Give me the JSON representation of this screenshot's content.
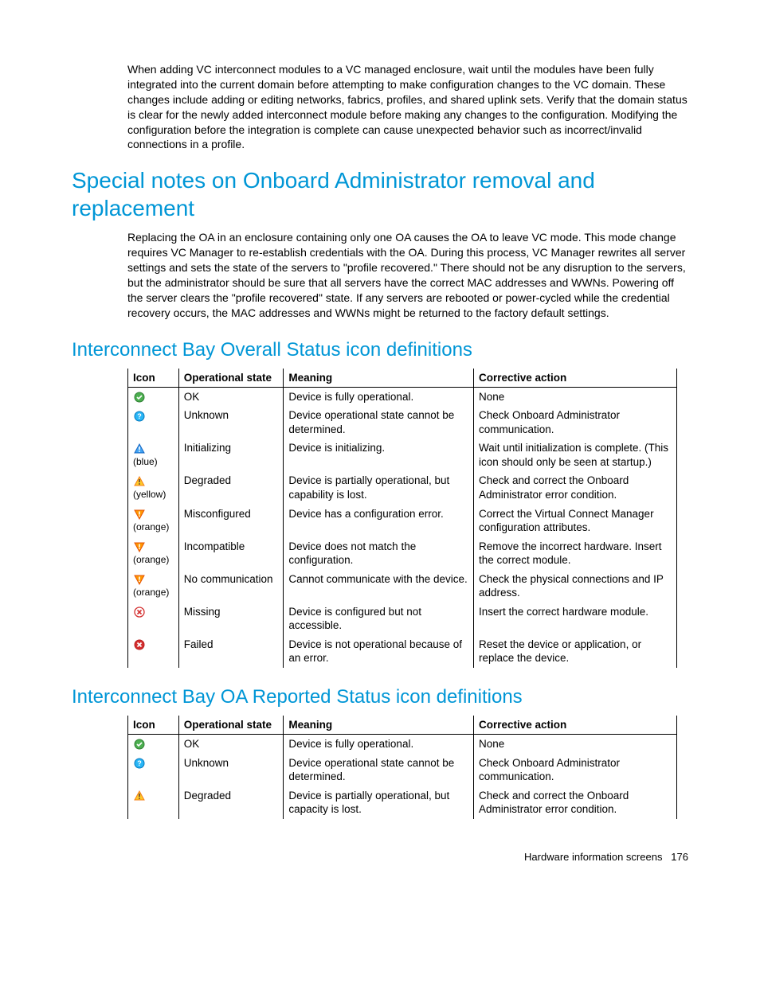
{
  "intro_para": "When adding VC interconnect modules to a VC managed enclosure, wait until the modules have been fully integrated into the current domain before attempting to make configuration changes to the VC domain. These changes include adding or editing networks, fabrics, profiles, and shared uplink sets. Verify that the domain status is clear for the newly added interconnect module before making any changes to the configuration. Modifying the configuration before the integration is complete can cause unexpected behavior such as incorrect/invalid connections in a profile.",
  "heading_special": "Special notes on Onboard Administrator removal and replacement",
  "special_para": "Replacing the OA in an enclosure containing only one OA causes the OA to leave VC mode. This mode change requires VC Manager to re-establish credentials with the OA. During this process, VC Manager rewrites all server settings and sets the state of the servers to \"profile recovered.\" There should not be any disruption to the servers, but the administrator should be sure that all servers have the correct MAC addresses and WWNs. Powering off the server clears the \"profile recovered\" state. If any servers are rebooted or power-cycled while the credential recovery occurs, the MAC addresses and WWNs might be returned to the factory default settings.",
  "heading_overall": "Interconnect Bay Overall Status icon definitions",
  "table_headers": {
    "icon": "Icon",
    "op": "Operational state",
    "mean": "Meaning",
    "act": "Corrective action"
  },
  "overall_rows": [
    {
      "icon_sub": "",
      "op": "OK",
      "mean": "Device is fully operational.",
      "act": "None"
    },
    {
      "icon_sub": "",
      "op": "Unknown",
      "mean": "Device operational state cannot be determined.",
      "act": "Check Onboard Administrator communication."
    },
    {
      "icon_sub": "(blue)",
      "op": "Initializing",
      "mean": "Device is initializing.",
      "act": "Wait until initialization is complete. (This icon should only be seen at startup.)"
    },
    {
      "icon_sub": "(yellow)",
      "op": "Degraded",
      "mean": "Device is partially operational, but capability is lost.",
      "act": "Check and correct the Onboard Administrator error condition."
    },
    {
      "icon_sub": "(orange)",
      "op": "Misconfigured",
      "mean": "Device has a configuration error.",
      "act": "Correct the Virtual Connect Manager configuration attributes."
    },
    {
      "icon_sub": "(orange)",
      "op": "Incompatible",
      "mean": "Device does not match the configuration.",
      "act": "Remove the incorrect hardware. Insert the correct module."
    },
    {
      "icon_sub": "(orange)",
      "op": "No communication",
      "mean": "Cannot communicate with the device.",
      "act": "Check the physical connections and IP address."
    },
    {
      "icon_sub": "",
      "op": "Missing",
      "mean": "Device is configured but not accessible.",
      "act": "Insert the correct hardware module."
    },
    {
      "icon_sub": "",
      "op": "Failed",
      "mean": "Device is not operational because of an error.",
      "act": "Reset the device or application, or replace the device."
    }
  ],
  "heading_oa": "Interconnect Bay OA Reported Status icon definitions",
  "oa_rows": [
    {
      "icon_sub": "",
      "op": "OK",
      "mean": "Device is fully operational.",
      "act": "None"
    },
    {
      "icon_sub": "",
      "op": "Unknown",
      "mean": "Device operational state cannot be determined.",
      "act": "Check Onboard Administrator communication."
    },
    {
      "icon_sub": "",
      "op": "Degraded",
      "mean": "Device is partially operational, but capacity is lost.",
      "act": "Check and correct the Onboard Administrator error condition."
    }
  ],
  "footer_text": "Hardware information screens",
  "footer_page": "176",
  "chart_data": null
}
